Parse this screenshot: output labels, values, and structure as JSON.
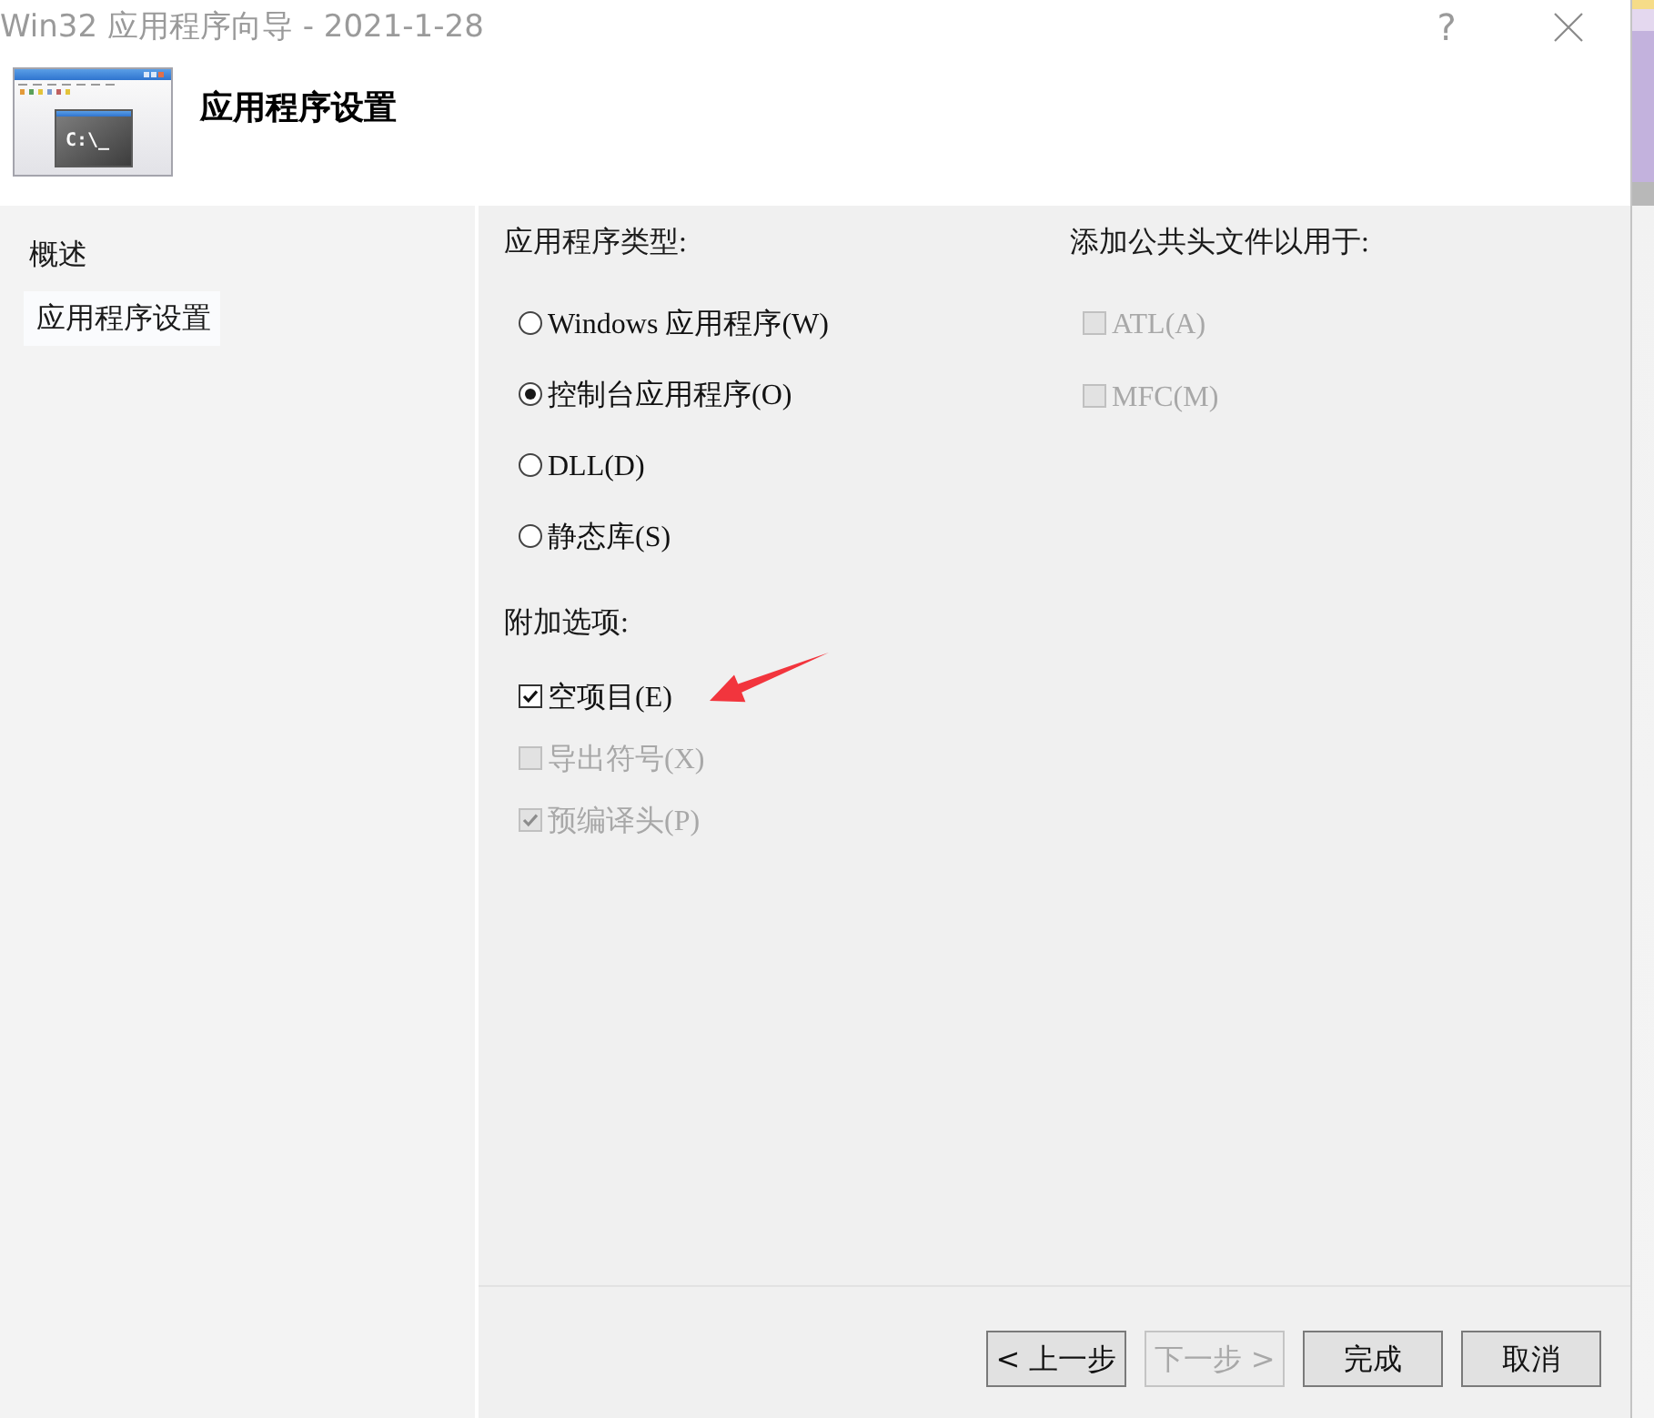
{
  "window": {
    "title": "Win32 应用程序向导 - 2021-1-28",
    "help_label": "?"
  },
  "header": {
    "title": "应用程序设置",
    "icon_text": "C:\\_"
  },
  "sidebar": {
    "items": [
      {
        "label": "概述",
        "selected": false
      },
      {
        "label": "应用程序设置",
        "selected": true
      }
    ]
  },
  "application_type": {
    "heading": "应用程序类型:",
    "options": [
      {
        "label": "Windows 应用程序(W)",
        "selected": false
      },
      {
        "label": "控制台应用程序(O)",
        "selected": true
      },
      {
        "label": "DLL(D)",
        "selected": false
      },
      {
        "label": "静态库(S)",
        "selected": false
      }
    ]
  },
  "additional_options": {
    "heading": "附加选项:",
    "options": [
      {
        "label": "空项目(E)",
        "checked": true,
        "disabled": false
      },
      {
        "label": "导出符号(X)",
        "checked": false,
        "disabled": true
      },
      {
        "label": "预编译头(P)",
        "checked": true,
        "disabled": true
      }
    ]
  },
  "common_headers": {
    "heading": "添加公共头文件以用于:",
    "options": [
      {
        "label": "ATL(A)",
        "checked": false,
        "disabled": true
      },
      {
        "label": "MFC(M)",
        "checked": false,
        "disabled": true
      }
    ]
  },
  "buttons": [
    {
      "label": "< 上一步",
      "disabled": false
    },
    {
      "label": "下一步 >",
      "disabled": true
    },
    {
      "label": "完成",
      "disabled": false
    },
    {
      "label": "取消",
      "disabled": false
    }
  ]
}
